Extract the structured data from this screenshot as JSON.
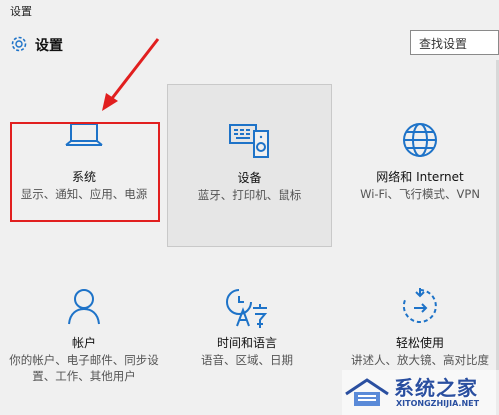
{
  "window": {
    "title": "设置"
  },
  "header": {
    "icon": "gear-icon",
    "title": "设置"
  },
  "search": {
    "placeholder": "查找设置"
  },
  "tiles": [
    {
      "id": "system",
      "icon": "laptop-icon",
      "title": "系统",
      "desc": "显示、通知、应用、电源"
    },
    {
      "id": "devices",
      "icon": "devices-icon",
      "title": "设备",
      "desc": "蓝牙、打印机、鼠标"
    },
    {
      "id": "network",
      "icon": "globe-icon",
      "title": "网络和 Internet",
      "desc": "Wi-Fi、飞行模式、VPN"
    },
    {
      "id": "accounts",
      "icon": "person-icon",
      "title": "帐户",
      "desc": "你的帐户、电子邮件、同步设置、工作、其他用户"
    },
    {
      "id": "time",
      "icon": "time-language-icon",
      "title": "时间和语言",
      "desc": "语音、区域、日期"
    },
    {
      "id": "ease",
      "icon": "ease-of-access-icon",
      "title": "轻松使用",
      "desc": "讲述人、放大镜、高对比度"
    }
  ],
  "watermark": {
    "brand": "系统之家",
    "domain": "XITONGZHIJIA.NET"
  },
  "colors": {
    "accent": "#1e73c8",
    "highlight": "#e11f1f",
    "background": "#f0f0f0"
  }
}
